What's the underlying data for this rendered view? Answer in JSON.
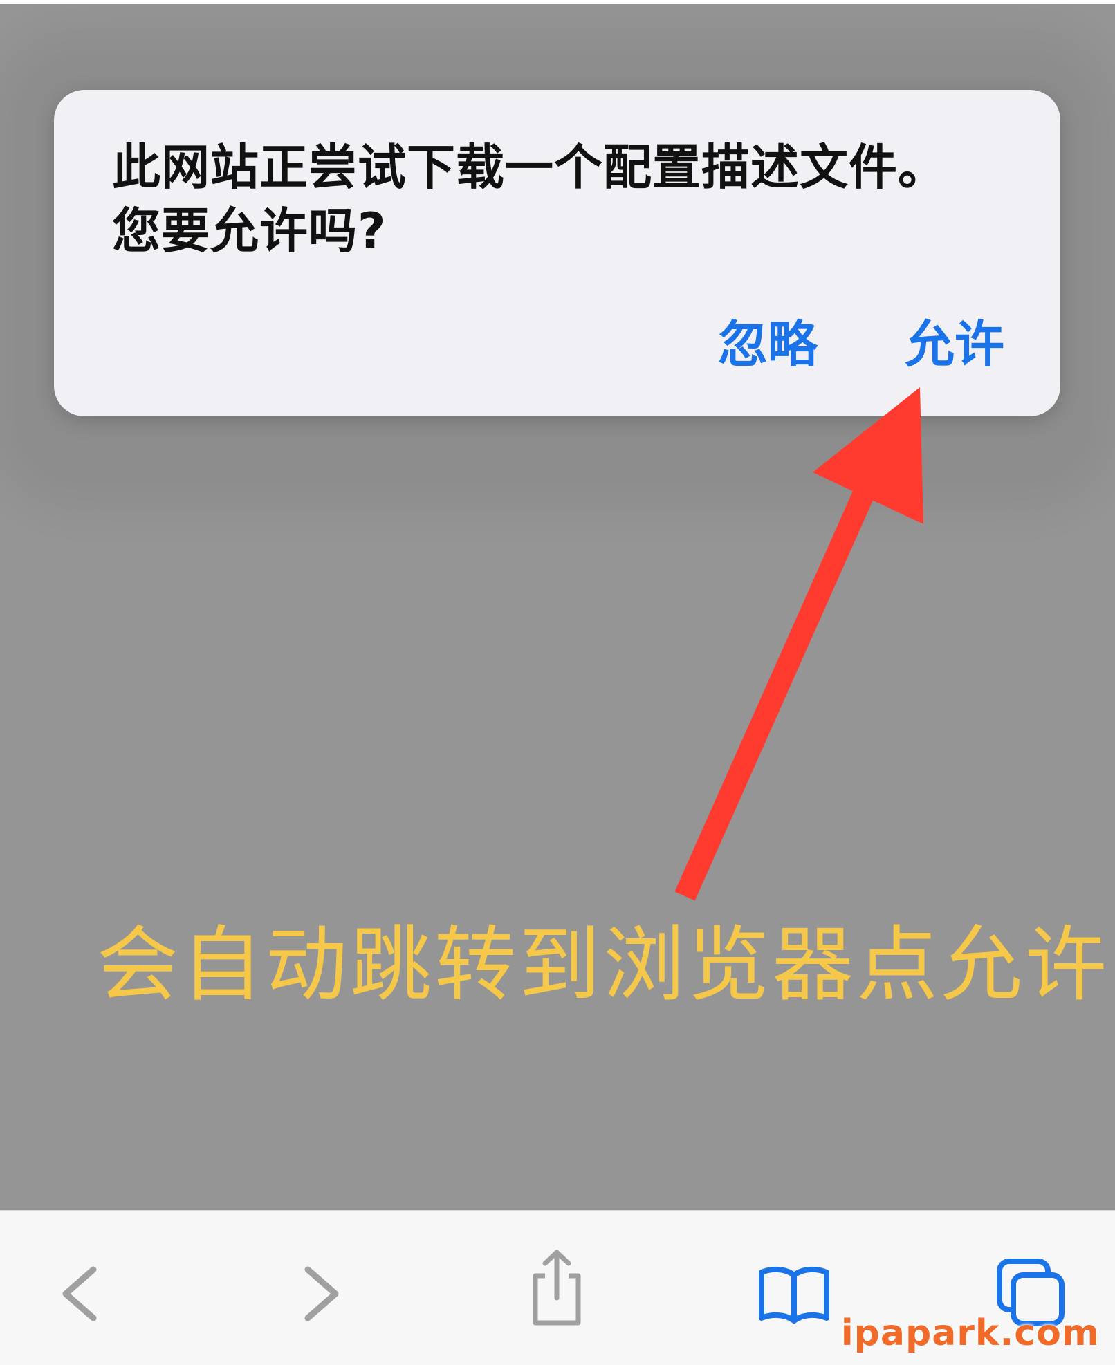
{
  "alert": {
    "message_line1": "此网站正尝试下载一个配置描述文件。",
    "message_line2": "您要允许吗?",
    "ignore_label": "忽略",
    "allow_label": "允许"
  },
  "annotation": {
    "caption": "会自动跳转到浏览器点允许",
    "arrow_color": "#ff3b30",
    "caption_color": "#f6c84a"
  },
  "toolbar": {
    "icons": [
      "chevron-left-icon",
      "chevron-right-icon",
      "share-icon",
      "book-icon",
      "tabs-icon"
    ],
    "inactive_color": "#a0a0a0",
    "accent_color": "#1a73e8"
  },
  "watermark": {
    "text": "ipapark.com",
    "color": "#f06a2a"
  }
}
